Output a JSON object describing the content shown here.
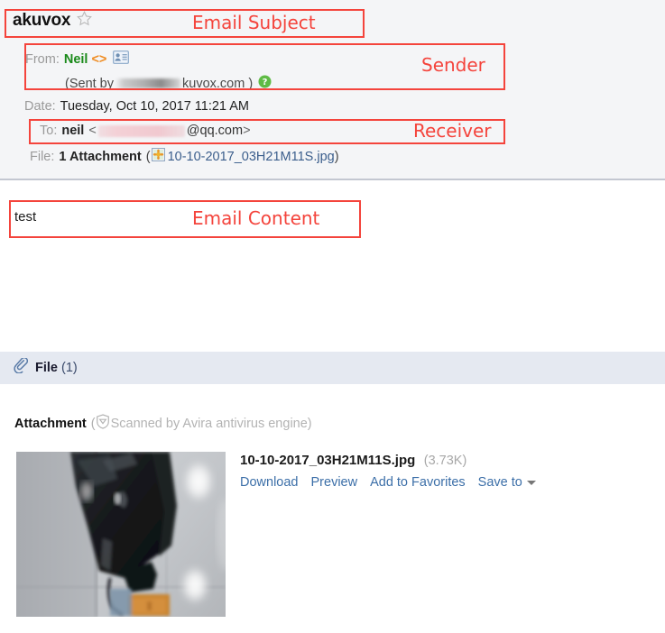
{
  "email": {
    "subject": "akuvox",
    "star_icon": "star-outline-icon",
    "header_rows": {
      "from": {
        "label": "From:",
        "name": "Neil",
        "brackets": "<>",
        "contact_icon": "contact-card-icon"
      },
      "sent_by": {
        "prefix": "(Sent by",
        "redacted": "",
        "domain": "kuvox.com",
        "suffix": ")",
        "help_icon": "help-question-icon"
      },
      "date": {
        "label": "Date:",
        "value": "Tuesday, Oct 10, 2017 11:21 AM"
      },
      "to": {
        "label": "To:",
        "name": "neil",
        "open_bracket": "<",
        "redacted": "",
        "domain": "@qq.com",
        "close_bracket": ">"
      },
      "file": {
        "label": "File:",
        "count_text": "1 Attachment",
        "open_paren": "(",
        "image_icon": "image-thumbnail-icon",
        "filename": "10-10-2017_03H21M11S.jpg",
        "close_paren": ")"
      }
    },
    "body": {
      "text": "test"
    }
  },
  "file_section": {
    "clip_icon": "paperclip-icon",
    "title": "File",
    "count": "(1)",
    "attachment_label": "Attachment",
    "scan_open_paren": "(",
    "shield_icon": "shield-scanned-icon",
    "scan_text": "Scanned by Avira antivirus engine)",
    "attachment": {
      "thumbnail_alt": "attachment-photo-thumbnail",
      "filename": "10-10-2017_03H21M11S.jpg",
      "size": "(3.73K)",
      "actions": [
        {
          "label": "Download"
        },
        {
          "label": "Preview"
        },
        {
          "label": "Add to Favorites"
        },
        {
          "label": "Save to"
        }
      ],
      "save_caret_icon": "caret-down-icon"
    }
  },
  "annotations": {
    "color": "#f4443c",
    "subject": "Email Subject",
    "sender": "Sender",
    "receiver": "Receiver",
    "content": "Email Content"
  },
  "colors": {
    "header_bg": "#f4f5f7",
    "file_bar_bg": "#e5e9f1",
    "link": "#3c6fa8",
    "from_name": "#1a8a1a",
    "annotation_red": "#f4443c"
  }
}
